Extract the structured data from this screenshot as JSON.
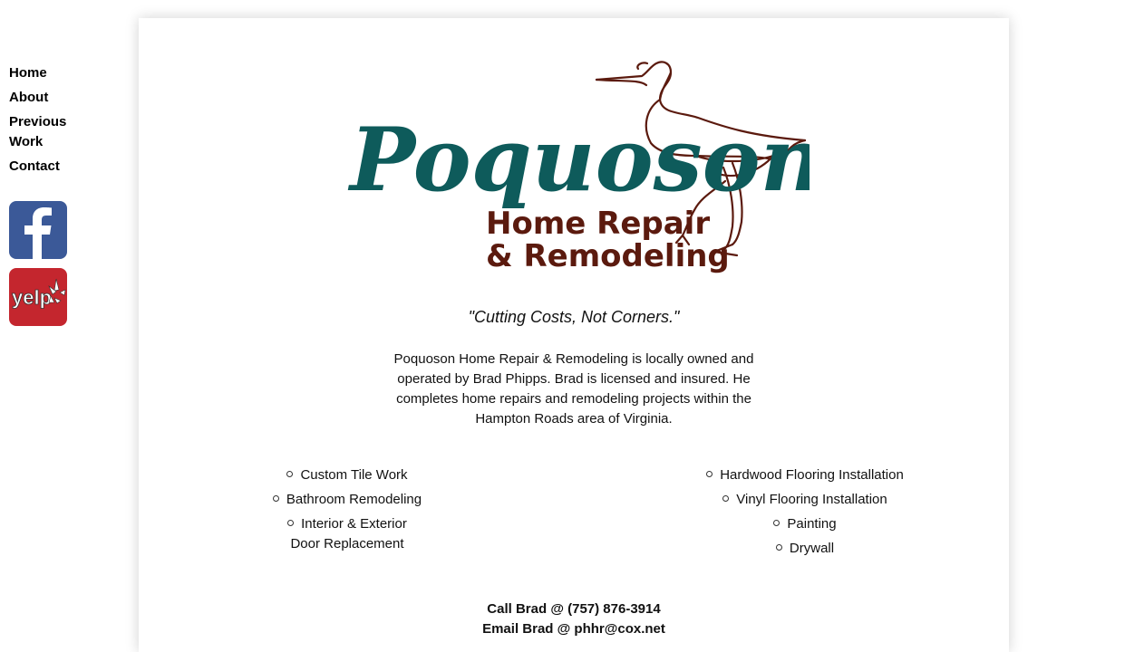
{
  "nav": {
    "items": [
      {
        "label": "Home"
      },
      {
        "label": "About"
      },
      {
        "label": "Previous Work"
      },
      {
        "label": "Contact"
      }
    ]
  },
  "social": {
    "facebook_icon": "facebook-icon",
    "yelp_icon": "yelp-icon",
    "yelp_text": "yelp"
  },
  "logo": {
    "name": "Poquoson",
    "line1": "Home Repair",
    "line2": "& Remodeling",
    "colors": {
      "teal": "#0e5b5b",
      "brown": "#5b1a0e"
    }
  },
  "tagline": "\"Cutting Costs, Not Corners.\"",
  "intro": "Poquoson Home Repair & Remodeling is locally owned and operated by Brad Phipps. Brad is licensed and insured. He completes home repairs and remodeling projects within the Hampton Roads area of Virginia.",
  "services_left": [
    "Custom Tile Work",
    "Bathroom Remodeling",
    "Interior & Exterior Door Replacement"
  ],
  "services_right": [
    "Hardwood Flooring Installation",
    "Vinyl Flooring Installation",
    "Painting",
    "Drywall"
  ],
  "contact": {
    "phone_line": "Call Brad @ (757) 876-3914",
    "email_line": "Email Brad @ phhr@cox.net"
  }
}
